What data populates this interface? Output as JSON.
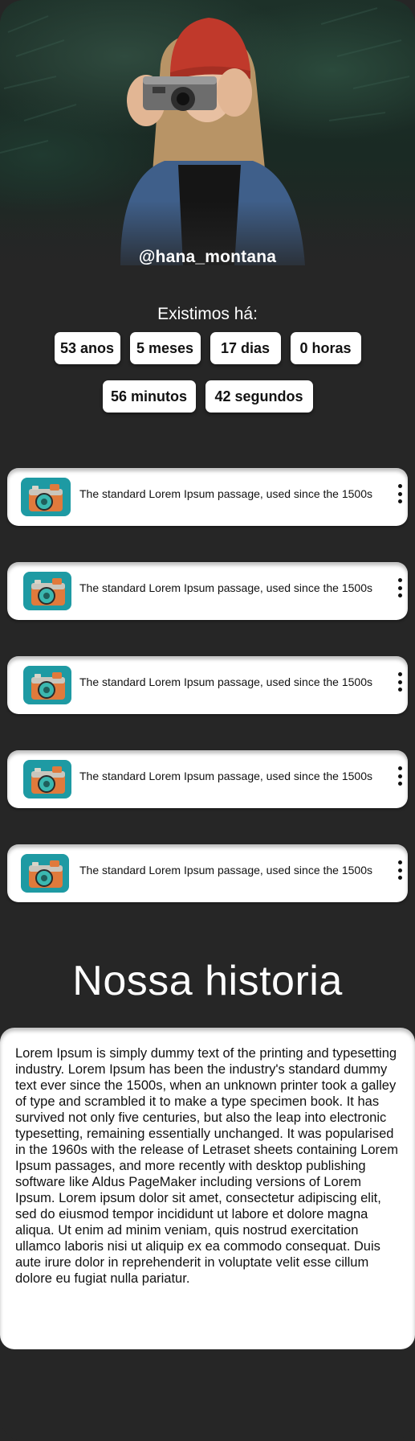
{
  "profile": {
    "username": "@hana_montana"
  },
  "existence": {
    "title": "Existimos há:",
    "counters_row1": [
      "53 anos",
      "5 meses",
      "17 dias",
      "0 horas"
    ],
    "counters_row2": [
      "56 minutos",
      "42 segundos"
    ]
  },
  "posts": [
    {
      "text": "The standard Lorem Ipsum passage, used since the 1500s",
      "icon": "camera-app-icon"
    },
    {
      "text": "The standard Lorem Ipsum passage, used since the 1500s",
      "icon": "camera-app-icon"
    },
    {
      "text": "The standard Lorem Ipsum passage, used since the 1500s",
      "icon": "camera-app-icon"
    },
    {
      "text": "The standard Lorem Ipsum passage, used since the 1500s",
      "icon": "camera-app-icon"
    },
    {
      "text": "The standard Lorem Ipsum passage, used since the 1500s",
      "icon": "camera-app-icon"
    }
  ],
  "history": {
    "title": "Nossa historia",
    "body": "Lorem Ipsum is simply dummy text of the printing and typesetting industry. Lorem Ipsum has been the industry's standard dummy text ever since the 1500s, when an unknown printer took a galley of type and scrambled it to make a type specimen book. It has survived not only five centuries, but also the leap into electronic typesetting, remaining essentially unchanged. It was popularised in the 1960s with the release of Letraset sheets containing Lorem Ipsum passages, and more recently with desktop publishing software like Aldus PageMaker including versions of Lorem Ipsum. Lorem ipsum dolor sit amet, consectetur adipiscing elit, sed do eiusmod tempor incididunt ut labore et dolore magna aliqua. Ut enim ad minim veniam, quis nostrud exercitation ullamco laboris nisi ut aliquip ex ea commodo consequat. Duis aute irure dolor in reprehenderit in voluptate velit esse cillum dolore eu fugiat nulla pariatur."
  },
  "colors": {
    "background": "#262626",
    "card": "#ffffff",
    "thumb_bg": "#1e9aa3",
    "hat": "#c0392b",
    "jacket": "#3f5f8a"
  }
}
